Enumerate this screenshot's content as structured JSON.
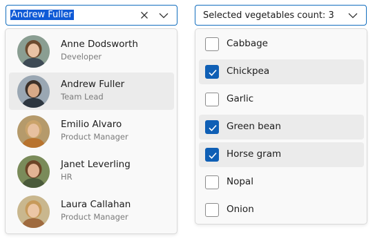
{
  "people_combo": {
    "input_value": "Andrew Fuller",
    "clear_icon": "close-icon",
    "dropdown_icon": "chevron-down-icon",
    "items": [
      {
        "name": "Anne Dodsworth",
        "role": "Developer",
        "avatar_colors": {
          "bg": "#8a9e92",
          "hair": "#6b4a2e",
          "skin": "#e9c2a4",
          "top": "#3e4a55"
        }
      },
      {
        "name": "Andrew Fuller",
        "role": "Team Lead",
        "avatar_colors": {
          "bg": "#9aa7b3",
          "hair": "#3c3028",
          "skin": "#d7a987",
          "top": "#2d3640"
        },
        "selected": true
      },
      {
        "name": "Emilio Alvaro",
        "role": "Product Manager",
        "avatar_colors": {
          "bg": "#b59a6b",
          "hair": "#caa36a",
          "skin": "#e7c09f",
          "top": "#b8732e"
        }
      },
      {
        "name": "Janet Leverling",
        "role": "HR",
        "avatar_colors": {
          "bg": "#7a8b5a",
          "hair": "#6b4426",
          "skin": "#e2b494",
          "top": "#4a5a3a"
        }
      },
      {
        "name": "Laura Callahan",
        "role": "Product Manager",
        "avatar_colors": {
          "bg": "#c9b78e",
          "hair": "#c79a5a",
          "skin": "#ecc6a5",
          "top": "#9f6a3e"
        }
      }
    ]
  },
  "veg_combo": {
    "label_prefix": "Selected vegetables count:",
    "count": "3",
    "dropdown_icon": "chevron-down-icon",
    "items": [
      {
        "label": "Cabbage",
        "checked": false
      },
      {
        "label": "Chickpea",
        "checked": true
      },
      {
        "label": "Garlic",
        "checked": false
      },
      {
        "label": "Green bean",
        "checked": true
      },
      {
        "label": "Horse gram",
        "checked": true
      },
      {
        "label": "Nopal",
        "checked": false
      },
      {
        "label": "Onion",
        "checked": false
      }
    ]
  },
  "colors": {
    "accent": "#0f6cbd",
    "selection": "#0f5ad6",
    "checkbox_checked": "#0f5fb5",
    "item_highlight": "#ebebeb",
    "popup_bg": "#f9f9f9"
  }
}
